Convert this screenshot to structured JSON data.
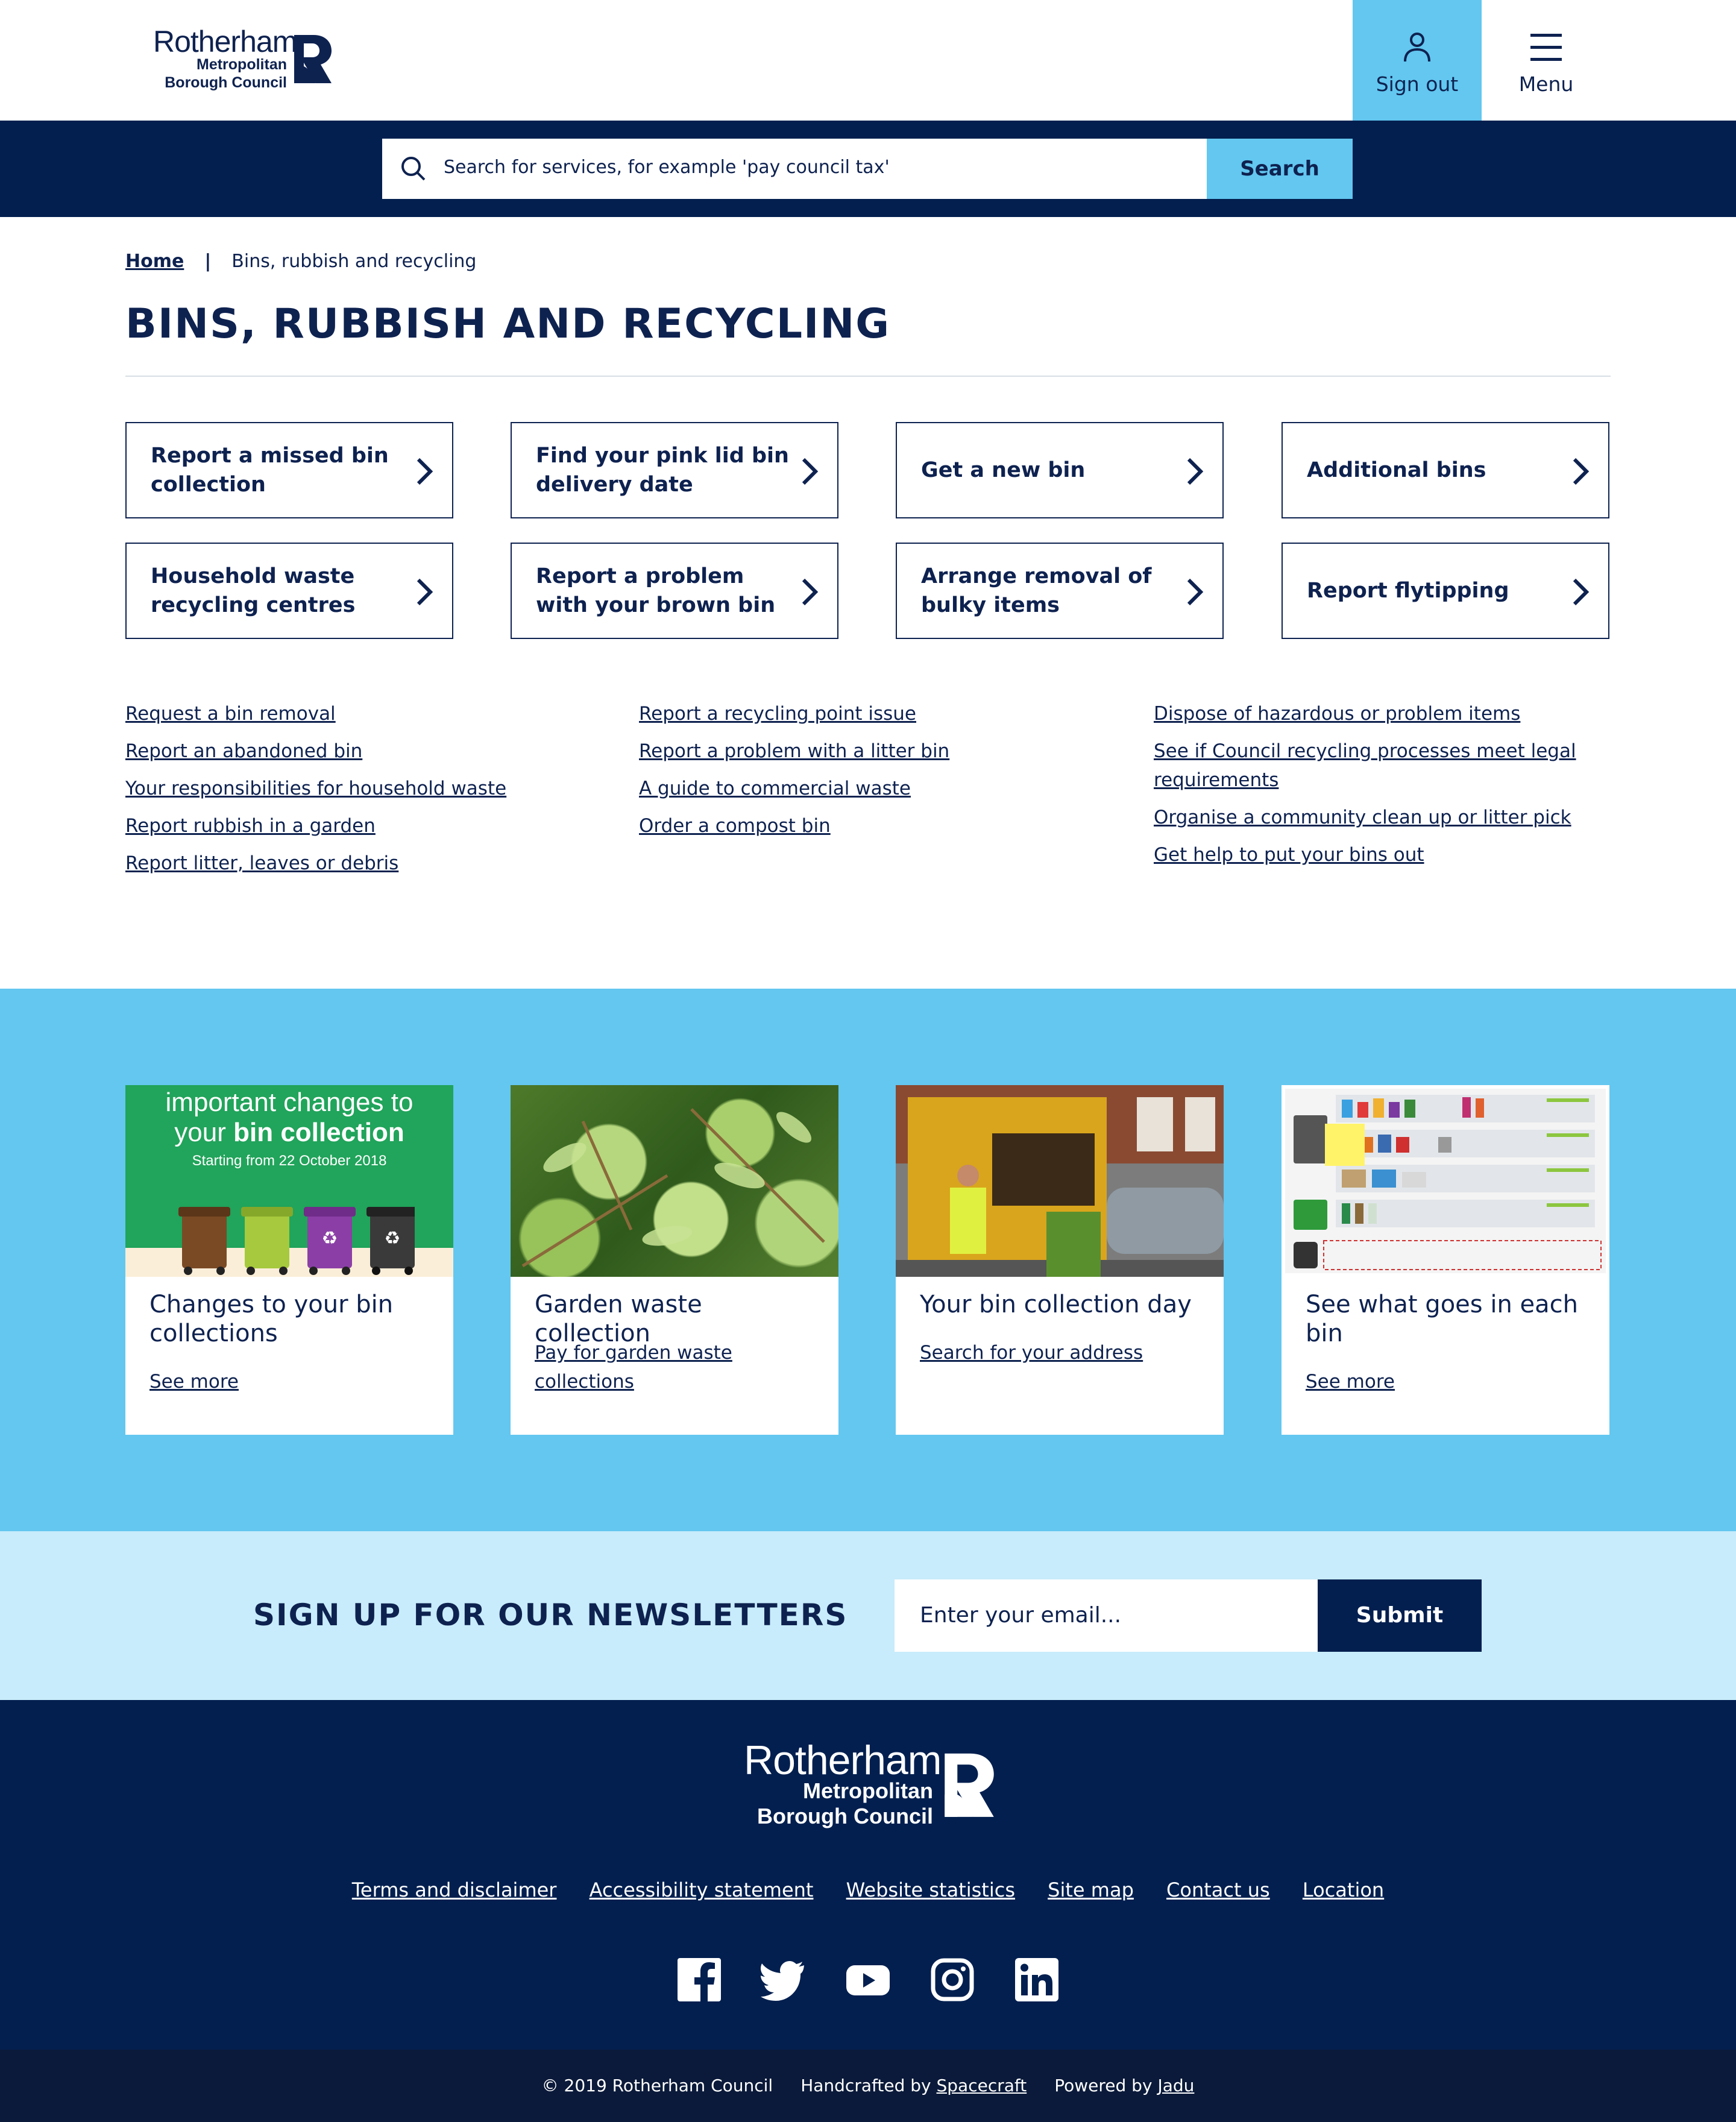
{
  "header": {
    "logo": {
      "line1": "Rotherham",
      "line2": "Metropolitan",
      "line3": "Borough Council"
    },
    "signout_label": "Sign out",
    "menu_label": "Menu"
  },
  "search": {
    "placeholder": "Search for services, for example 'pay council tax'",
    "button_label": "Search"
  },
  "breadcrumb": {
    "home": "Home",
    "separator": "|",
    "current": "Bins, rubbish and recycling"
  },
  "page_title": "BINS, RUBBISH AND RECYCLING",
  "tiles": [
    {
      "label": "Report a missed bin collection"
    },
    {
      "label": "Find your pink lid bin delivery date"
    },
    {
      "label": "Get a new bin"
    },
    {
      "label": "Additional bins"
    },
    {
      "label": "Household waste recycling centres"
    },
    {
      "label": "Report a problem with your brown bin"
    },
    {
      "label": "Arrange removal of bulky items"
    },
    {
      "label": "Report flytipping"
    }
  ],
  "links": {
    "col1": [
      "Request a bin removal",
      "Report an abandoned bin",
      "Your responsibilities for household waste",
      "Report rubbish in a garden",
      "Report litter, leaves or debris"
    ],
    "col2": [
      "Report a recycling point issue",
      "Report a problem with a litter bin",
      "A guide to commercial waste",
      "Order a compost bin"
    ],
    "col3": [
      "Dispose of hazardous or problem items",
      "See if Council recycling processes meet legal requirements",
      "Organise a community clean up or litter pick",
      "Get help to put your bins out"
    ]
  },
  "cards": [
    {
      "title": "Changes to your bin collections",
      "link": "See more",
      "image_text": {
        "line1": "important changes to",
        "line2a": "your ",
        "line2b": "bin collection",
        "line3": "Starting from 22 October 2018"
      }
    },
    {
      "title": "Garden waste collection",
      "link": "Pay for garden waste collections"
    },
    {
      "title": "Your bin collection day",
      "link": "Search for your address"
    },
    {
      "title": "See what goes in each bin",
      "link": "See more"
    }
  ],
  "newsletter": {
    "title": "SIGN UP FOR OUR NEWSLETTERS",
    "placeholder": "Enter your email...",
    "button_label": "Submit"
  },
  "footer": {
    "logo": {
      "line1": "Rotherham",
      "line2": "Metropolitan",
      "line3": "Borough Council"
    },
    "links": [
      "Terms and disclaimer",
      "Accessibility statement",
      "Website statistics",
      "Site map",
      "Contact us",
      "Location"
    ],
    "social_icons": [
      "facebook-icon",
      "twitter-icon",
      "youtube-icon",
      "instagram-icon",
      "linkedin-icon"
    ],
    "copyright": "© 2019 Rotherham Council",
    "handcrafted_prefix": "Handcrafted by",
    "handcrafted_link": "Spacecraft",
    "powered_prefix": "Powered by",
    "powered_link": "Jadu"
  },
  "colors": {
    "navy": "#021f4f",
    "text": "#0e2250",
    "sky": "#63c7f0",
    "pale": "#c8ecfb"
  }
}
